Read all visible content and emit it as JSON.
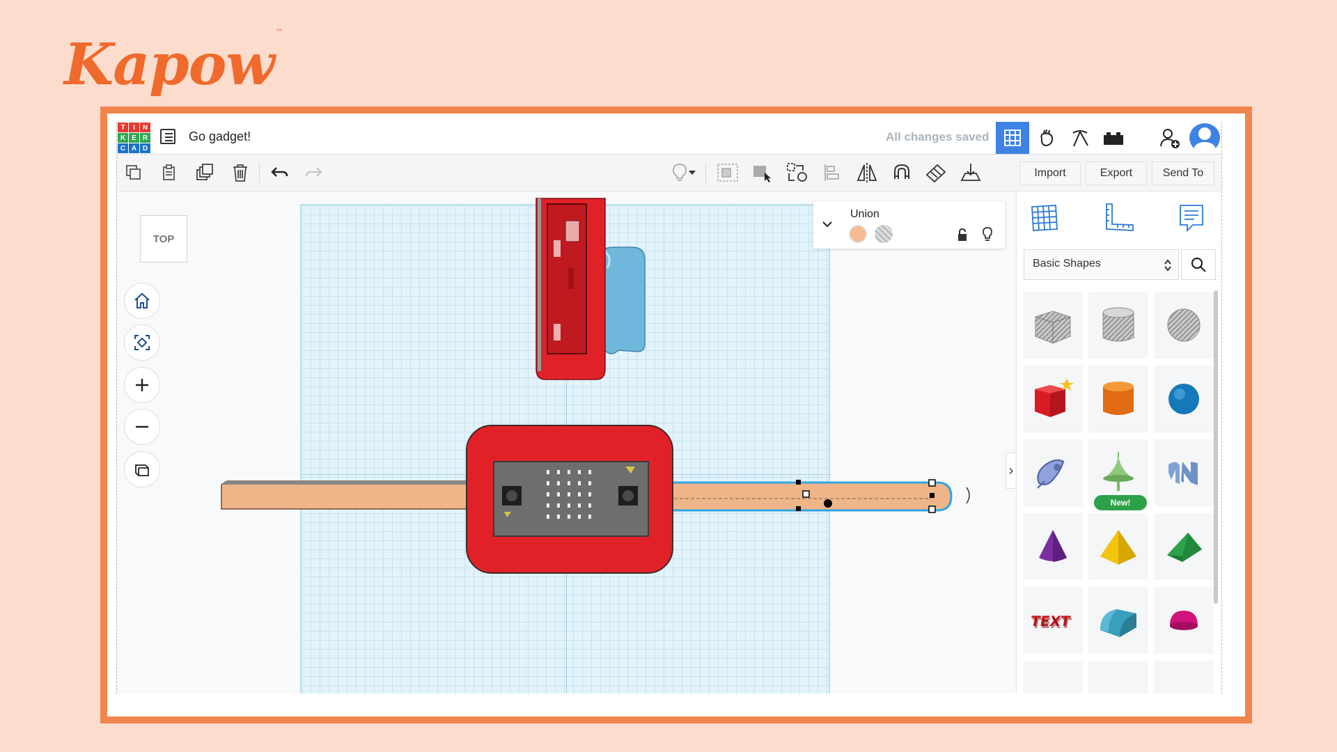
{
  "brand": {
    "name": "Kapow",
    "tm": "™"
  },
  "app": {
    "logo_letters": [
      "T",
      "I",
      "N",
      "K",
      "E",
      "R",
      "C",
      "A",
      "D"
    ],
    "logo_colors": [
      "#e8382f",
      "#e8382f",
      "#e8382f",
      "#2fa84f",
      "#2fa84f",
      "#2fa84f",
      "#1b73c8",
      "#1b73c8",
      "#1b73c8"
    ],
    "project_title": "Go gadget!",
    "save_status": "All changes saved",
    "accent": "#3f82e6"
  },
  "topbar_icons": [
    "grid-view-icon",
    "tinker-hand-icon",
    "pickaxe-icon",
    "bricks-icon",
    "add-user-icon",
    "user-avatar-icon"
  ],
  "toolbar": {
    "left_tools": [
      "copy-icon",
      "paste-icon",
      "duplicate-icon",
      "delete-icon",
      "undo-icon",
      "redo-icon"
    ],
    "right_tools": [
      "light-bulb-icon",
      "group-icon",
      "ungroup-icon",
      "cruise-icon",
      "align-icon",
      "mirror-icon",
      "magnet-icon",
      "workplane-icon",
      "ruler-drop-icon"
    ],
    "import_label": "Import",
    "export_label": "Export",
    "send_to_label": "Send To"
  },
  "viewport": {
    "view_cube_label": "TOP",
    "nav_buttons": [
      "home-icon",
      "fit-view-icon",
      "zoom-in-icon",
      "zoom-out-icon",
      "perspective-icon"
    ]
  },
  "inspector": {
    "title": "Union",
    "solid_color": "#f6bb90",
    "hole_color": "#bdbdbd"
  },
  "panel": {
    "tabs": [
      "workplane-grid-icon",
      "ruler-icon",
      "notes-icon"
    ],
    "category": "Basic Shapes",
    "shapes": [
      "box-hole",
      "cylinder-hole",
      "sphere-hole",
      "box",
      "cylinder",
      "sphere",
      "scribble",
      "new-shape",
      "text-3d",
      "cone",
      "pyramid",
      "wedge",
      "text",
      "half-cylinder",
      "half-sphere"
    ],
    "new_badge": "New!"
  },
  "colors": {
    "red": "#e02128",
    "belt": "#efb589",
    "blue_shape": "#6fb8dc",
    "frame": "#f0854d",
    "background": "#fbdccd"
  }
}
